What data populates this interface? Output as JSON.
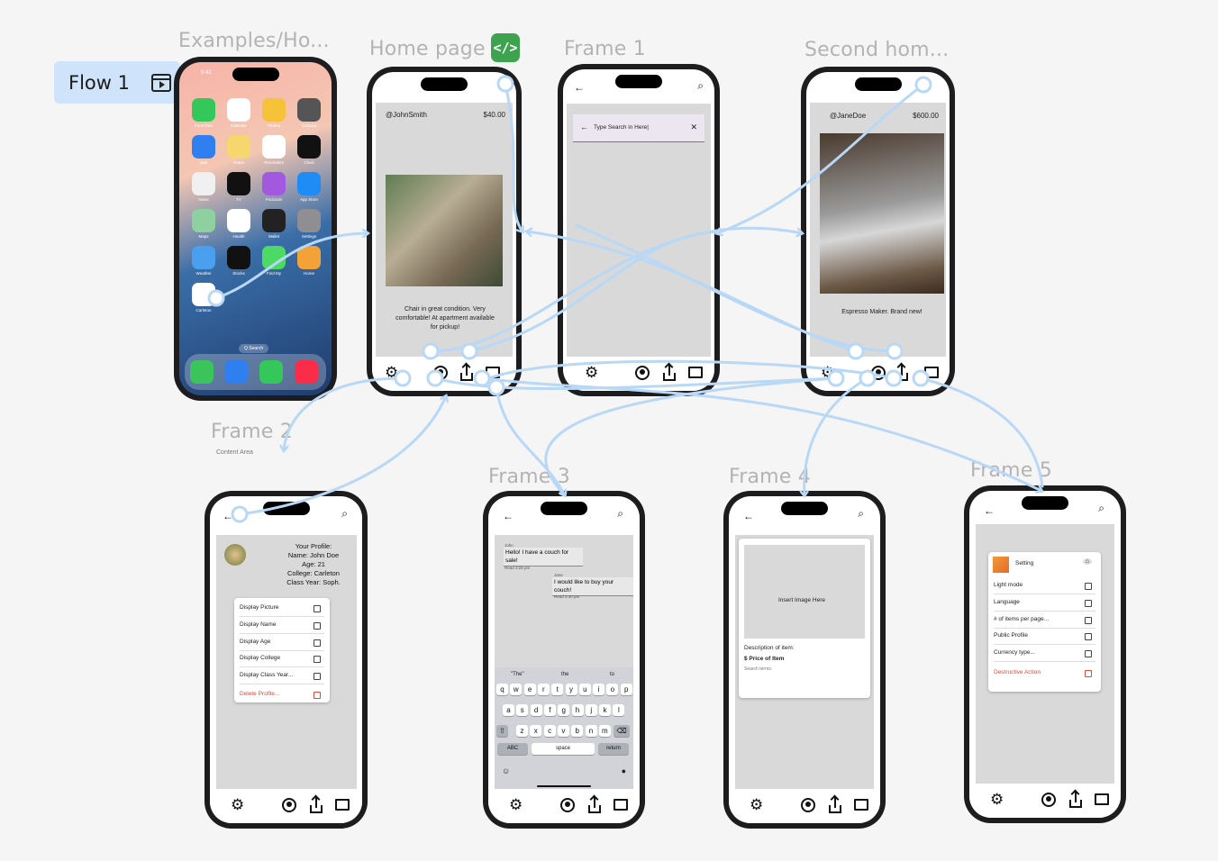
{
  "flow": {
    "label": "Flow 1",
    "icon": "play-frame-icon"
  },
  "frames": {
    "examples": "Examples/Ho...",
    "home": "Home page",
    "frame1": "Frame 1",
    "second": "Second hom...",
    "frame2": "Frame 2",
    "frame2_sub": "Content Area",
    "frame3": "Frame 3",
    "frame4": "Frame 4",
    "frame5": "Frame 5"
  },
  "code_badge": "</>",
  "ios": {
    "time": "9:41",
    "date_day": "MON",
    "date_num": "10",
    "search": "Q Search",
    "apps": [
      "FaceTime",
      "Calendar",
      "Photos",
      "Camera",
      "Mail",
      "Notes",
      "Reminders",
      "Clock",
      "News",
      "TV",
      "Podcasts",
      "App Store",
      "Maps",
      "Health",
      "Wallet",
      "Settings",
      "Weather",
      "Stocks",
      "Find My",
      "Home",
      "Carleton"
    ],
    "tv_label": "tv"
  },
  "home": {
    "user": "@JohnSmith",
    "price": "$40.00",
    "desc": "Chair in great condition. Very comfortable! At apartment available for pickup!"
  },
  "frame1": {
    "search_placeholder": "Type Search in Here|"
  },
  "second": {
    "user": "@JaneDoe",
    "price": "$600.00",
    "desc": "Espresso Maker. Brand new!"
  },
  "profile": {
    "title": "Your Profile:",
    "name": "Name: John Doe",
    "age": "Age: 21",
    "college": "College: Carleton",
    "year": "Class Year: Soph.",
    "menu": [
      "Display Picture",
      "Display Name",
      "Display Age",
      "Display College",
      "Display Class Year..."
    ],
    "danger": "Delete Profile..."
  },
  "chat": {
    "m1_name": "John",
    "m1_text": "Hello! I have a couch for sale!",
    "m1_time": "Read 3:28 pm",
    "m2_name": "Jane",
    "m2_text": "I would like to buy your couch!",
    "m2_time": "Read 3:30 pm",
    "suggest": [
      "\"The\"",
      "the",
      "to"
    ],
    "row1": [
      "q",
      "w",
      "e",
      "r",
      "t",
      "y",
      "u",
      "i",
      "o",
      "p"
    ],
    "row2": [
      "a",
      "s",
      "d",
      "f",
      "g",
      "h",
      "j",
      "k",
      "l"
    ],
    "row3": [
      "z",
      "x",
      "c",
      "v",
      "b",
      "n",
      "m"
    ],
    "abc": "ABC",
    "space": "space",
    "return": "return"
  },
  "post": {
    "image": "Insert Image Here",
    "desc": "Description of item:",
    "price": "$ Price of Item",
    "terms": "Search terms:"
  },
  "settings": {
    "title": "Setting",
    "items": [
      "Light mode",
      "Language",
      "# of items per page...",
      "Public Profile",
      "Currency type..."
    ],
    "danger": "Destructive Action"
  },
  "colors": {
    "accent": "#cfe4fb",
    "link": "#b8d8f6",
    "code": "#3ea34f",
    "danger": "#e0483a"
  }
}
